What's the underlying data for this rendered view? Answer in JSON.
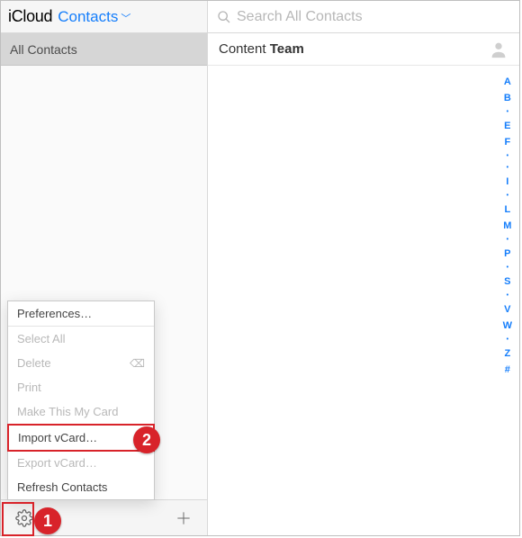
{
  "header": {
    "logo": "iCloud",
    "app_name": "Contacts",
    "search_placeholder": "Search All Contacts"
  },
  "sidebar": {
    "active_group": "All Contacts"
  },
  "contact": {
    "first": "Content",
    "last": "Team"
  },
  "alpha_index": [
    "A",
    "B",
    "•",
    "E",
    "F",
    "•",
    "•",
    "I",
    "•",
    "L",
    "M",
    "•",
    "P",
    "•",
    "S",
    "•",
    "V",
    "W",
    "•",
    "Z",
    "#"
  ],
  "menu": {
    "items": [
      {
        "label": "Preferences…",
        "disabled": false
      },
      {
        "sep": true
      },
      {
        "label": "Select All",
        "disabled": true
      },
      {
        "label": "Delete",
        "disabled": true,
        "trailing_icon": "backspace"
      },
      {
        "label": "Print",
        "disabled": true
      },
      {
        "label": "Make This My Card",
        "disabled": true
      },
      {
        "sep": true
      },
      {
        "label": "Import vCard…",
        "disabled": false,
        "highlight": true
      },
      {
        "label": "Export vCard…",
        "disabled": true
      },
      {
        "label": "Refresh Contacts",
        "disabled": false
      }
    ]
  },
  "annotations": {
    "callout1": "1",
    "callout2": "2"
  }
}
